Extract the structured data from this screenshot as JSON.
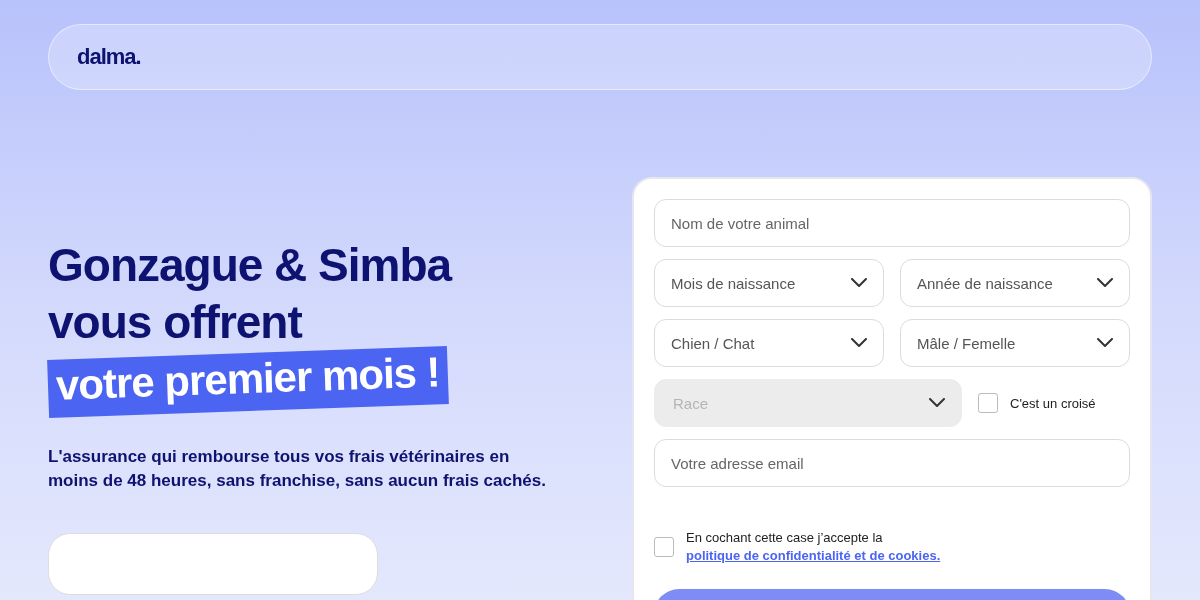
{
  "header": {
    "logo": "dalma."
  },
  "hero": {
    "title_lines": [
      "Gonzague & Simba",
      "vous offrent"
    ],
    "highlight": "votre premier mois !",
    "subtitle": "L'assurance qui rembourse tous vos frais vétérinaires en moins de 48 heures, sans franchise, sans aucun frais cachés."
  },
  "form": {
    "rows": [
      [
        {
          "kind": "text",
          "placeholder": "Nom de votre animal"
        }
      ],
      [
        {
          "kind": "select",
          "placeholder": "Mois de naissance",
          "disabled": false
        },
        {
          "kind": "select",
          "placeholder": "Année de naissance",
          "disabled": false
        }
      ],
      [
        {
          "kind": "select",
          "placeholder": "Chien / Chat",
          "disabled": false
        },
        {
          "kind": "select",
          "placeholder": "Mâle / Femelle",
          "disabled": false
        }
      ],
      [
        {
          "kind": "select",
          "placeholder": "Race",
          "disabled": true
        },
        {
          "kind": "checkbox",
          "label": "C'est un croisé",
          "checked": false
        }
      ],
      [
        {
          "kind": "text",
          "placeholder": "Votre adresse email"
        }
      ]
    ],
    "consent": {
      "text": "En cochant cette case j’accepte la ",
      "link": "politique de confidentialité et de cookies.",
      "checked": false
    }
  }
}
